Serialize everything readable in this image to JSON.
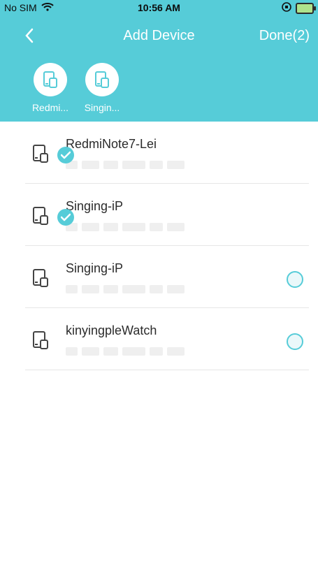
{
  "status_bar": {
    "carrier": "No SIM",
    "time": "10:56 AM"
  },
  "nav": {
    "title": "Add Device",
    "done_label": "Done(2)"
  },
  "selected_devices": [
    {
      "label": "Redmi..."
    },
    {
      "label": "Singin..."
    }
  ],
  "devices": [
    {
      "name": "RedmiNote7-Lei",
      "selected": true
    },
    {
      "name": "Singing-iP",
      "selected": true
    },
    {
      "name": "Singing-iP",
      "selected": false
    },
    {
      "name": "kinyingpleWatch",
      "selected": false
    }
  ],
  "colors": {
    "accent": "#56ccd8",
    "text": "#2b2b2b",
    "divider": "#e6e6e6"
  },
  "icons": {
    "wifi": "wifi-icon",
    "battery": "battery-icon",
    "back": "chevron-left-icon",
    "device": "device-icon",
    "check": "check-icon"
  }
}
